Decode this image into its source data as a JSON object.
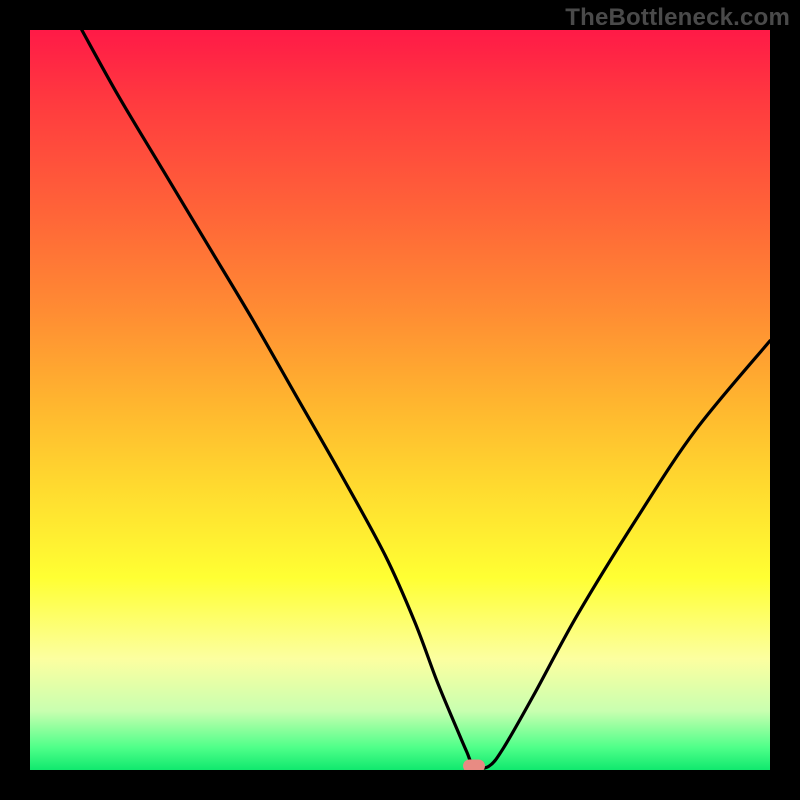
{
  "watermark": "TheBottleneck.com",
  "chart_data": {
    "type": "line",
    "title": "",
    "xlabel": "",
    "ylabel": "",
    "xlim": [
      0,
      100
    ],
    "ylim": [
      0,
      100
    ],
    "grid": false,
    "series": [
      {
        "name": "bottleneck-curve",
        "x": [
          7,
          12,
          18,
          24,
          30,
          36,
          42,
          48,
          52,
          55,
          57.5,
          59,
          60,
          62,
          64,
          68,
          74,
          82,
          90,
          100
        ],
        "y": [
          100,
          91,
          81,
          71,
          61,
          50.5,
          40,
          29,
          20,
          12,
          6,
          2.5,
          0.5,
          0.5,
          3,
          10,
          21,
          34,
          46,
          58
        ]
      }
    ],
    "annotations": [
      {
        "name": "optimal-marker",
        "x": 60,
        "y": 0.5,
        "color": "#e88b83"
      }
    ],
    "background_gradient_stops": [
      {
        "pos": 0,
        "color": "#ff1a47"
      },
      {
        "pos": 25,
        "color": "#ff6538"
      },
      {
        "pos": 50,
        "color": "#ffb42f"
      },
      {
        "pos": 74,
        "color": "#ffff33"
      },
      {
        "pos": 92,
        "color": "#c9ffb0"
      },
      {
        "pos": 100,
        "color": "#10e96e"
      }
    ]
  }
}
